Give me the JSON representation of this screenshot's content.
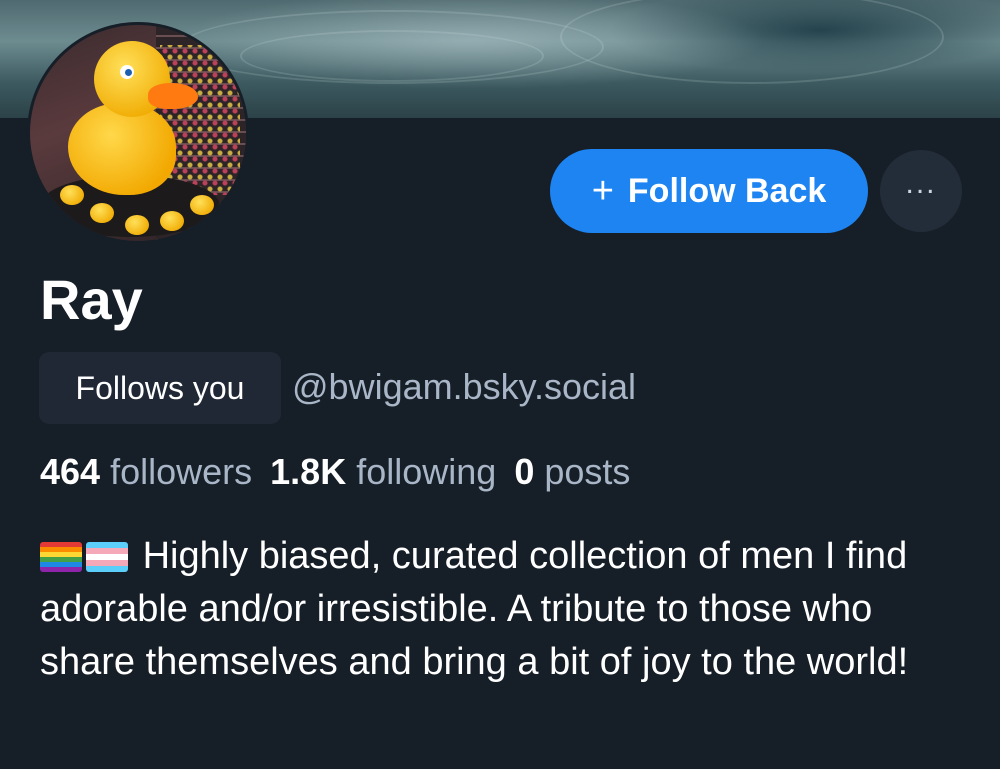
{
  "profile": {
    "display_name": "Ray",
    "handle": "@bwigam.bsky.social",
    "follows_you_label": "Follows you",
    "stats": {
      "followers_count": "464",
      "followers_label": "followers",
      "following_count": "1.8K",
      "following_label": "following",
      "posts_count": "0",
      "posts_label": "posts"
    },
    "bio_emoji": [
      "rainbow-flag-icon",
      "transgender-flag-icon"
    ],
    "bio_text": "Highly biased, curated collection of men I find adorable and/or irresistible. A tribute to those who share themselves and bring a bit of joy to the world!"
  },
  "actions": {
    "follow_back_label": "Follow Back",
    "follow_icon": "plus-icon",
    "more_icon": "ellipsis-icon"
  },
  "colors": {
    "background": "#161e27",
    "accent": "#1d84f2",
    "muted_text": "#a8b6c7",
    "badge_bg": "#1f2834"
  }
}
